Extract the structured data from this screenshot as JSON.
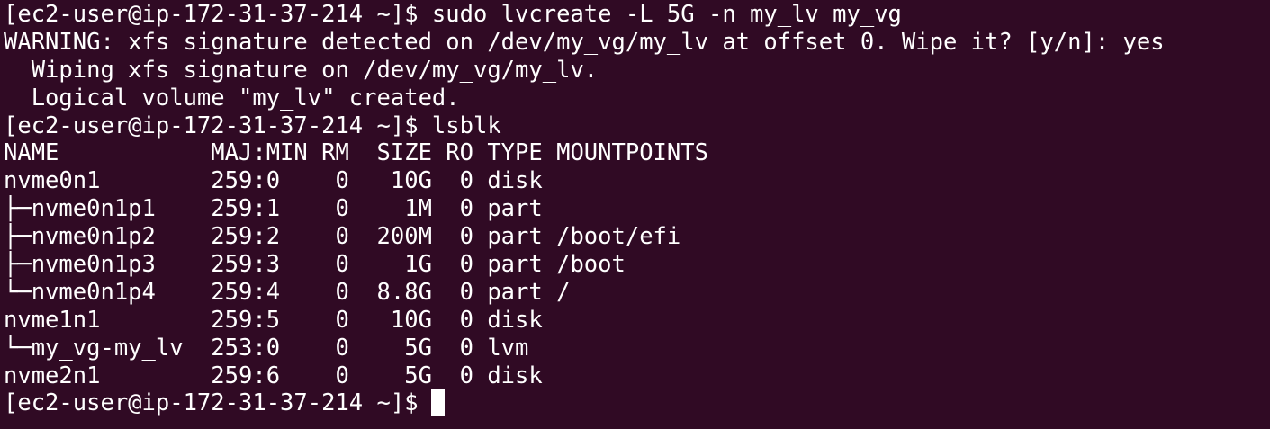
{
  "terminal": {
    "prompt": "[ec2-user@ip-172-31-37-214 ~]$",
    "lines": [
      "[ec2-user@ip-172-31-37-214 ~]$ sudo lvcreate -L 5G -n my_lv my_vg",
      "WARNING: xfs signature detected on /dev/my_vg/my_lv at offset 0. Wipe it? [y/n]: yes",
      "  Wiping xfs signature on /dev/my_vg/my_lv.",
      "  Logical volume \"my_lv\" created.",
      "[ec2-user@ip-172-31-37-214 ~]$ lsblk",
      "NAME           MAJ:MIN RM  SIZE RO TYPE MOUNTPOINTS",
      "nvme0n1        259:0    0   10G  0 disk",
      "├─nvme0n1p1    259:1    0    1M  0 part",
      "├─nvme0n1p2    259:2    0  200M  0 part /boot/efi",
      "├─nvme0n1p3    259:3    0    1G  0 part /boot",
      "└─nvme0n1p4    259:4    0  8.8G  0 part /",
      "nvme1n1        259:5    0   10G  0 disk",
      "└─my_vg-my_lv  253:0    0    5G  0 lvm",
      "nvme2n1        259:6    0    5G  0 disk"
    ]
  },
  "colors": {
    "background": "#300a24",
    "foreground": "#ffffff"
  }
}
